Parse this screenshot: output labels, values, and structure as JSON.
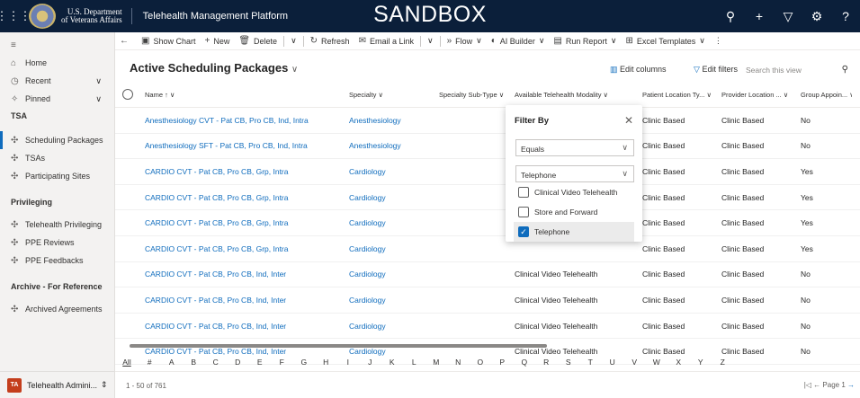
{
  "header": {
    "org_line1": "U.S. Department",
    "org_line2": "of Veterans Affairs",
    "app_title": "Telehealth Management Platform",
    "environment": "SANDBOX"
  },
  "sidebar": {
    "home": "Home",
    "recent": "Recent",
    "pinned": "Pinned",
    "group_tsa": "TSA",
    "scheduling": "Scheduling Packages",
    "tsas": "TSAs",
    "sites": "Participating Sites",
    "group_priv": "Privileging",
    "tele_priv": "Telehealth Privileging",
    "ppe_reviews": "PPE Reviews",
    "ppe_feedbacks": "PPE Feedbacks",
    "group_archive": "Archive - For Reference",
    "archived": "Archived Agreements",
    "area": "Telehealth Admini...",
    "area_badge": "TA"
  },
  "commands": {
    "show_chart": "Show Chart",
    "new": "New",
    "delete": "Delete",
    "refresh": "Refresh",
    "email_link": "Email a Link",
    "flow": "Flow",
    "ai_builder": "AI Builder",
    "run_report": "Run Report",
    "excel_templates": "Excel Templates"
  },
  "view": {
    "title": "Active Scheduling Packages",
    "edit_columns": "Edit columns",
    "edit_filters": "Edit filters",
    "search_placeholder": "Search this view"
  },
  "columns": [
    "Name ↑",
    "Specialty",
    "Specialty Sub-Type",
    "Available Telehealth Modality",
    "Patient Location Ty...",
    "Provider Location ...",
    "Group Appoin..."
  ],
  "rows": [
    {
      "name": "Anesthesiology CVT - Pat CB, Pro CB, Ind, Intra",
      "specialty": "Anesthesiology",
      "subtype": "",
      "modality": "",
      "patient_loc": "Clinic Based",
      "provider_loc": "Clinic Based",
      "group": "No"
    },
    {
      "name": "Anesthesiology SFT - Pat CB, Pro CB, Ind, Intra",
      "specialty": "Anesthesiology",
      "subtype": "",
      "modality": "",
      "patient_loc": "Clinic Based",
      "provider_loc": "Clinic Based",
      "group": "No"
    },
    {
      "name": "CARDIO CVT - Pat CB, Pro CB, Grp, Intra",
      "specialty": "Cardiology",
      "subtype": "",
      "modality": "",
      "patient_loc": "Clinic Based",
      "provider_loc": "Clinic Based",
      "group": "Yes"
    },
    {
      "name": "CARDIO CVT - Pat CB, Pro CB, Grp, Intra",
      "specialty": "Cardiology",
      "subtype": "",
      "modality": "",
      "patient_loc": "Clinic Based",
      "provider_loc": "Clinic Based",
      "group": "Yes"
    },
    {
      "name": "CARDIO CVT - Pat CB, Pro CB, Grp, Intra",
      "specialty": "Cardiology",
      "subtype": "",
      "modality": "",
      "patient_loc": "Clinic Based",
      "provider_loc": "Clinic Based",
      "group": "Yes"
    },
    {
      "name": "CARDIO CVT - Pat CB, Pro CB, Grp, Intra",
      "specialty": "Cardiology",
      "subtype": "",
      "modality": "",
      "patient_loc": "Clinic Based",
      "provider_loc": "Clinic Based",
      "group": "Yes"
    },
    {
      "name": "CARDIO CVT - Pat CB, Pro CB, Ind, Inter",
      "specialty": "Cardiology",
      "subtype": "",
      "modality": "Clinical Video Telehealth",
      "patient_loc": "Clinic Based",
      "provider_loc": "Clinic Based",
      "group": "No"
    },
    {
      "name": "CARDIO CVT - Pat CB, Pro CB, Ind, Inter",
      "specialty": "Cardiology",
      "subtype": "",
      "modality": "Clinical Video Telehealth",
      "patient_loc": "Clinic Based",
      "provider_loc": "Clinic Based",
      "group": "No"
    },
    {
      "name": "CARDIO CVT - Pat CB, Pro CB, Ind, Inter",
      "specialty": "Cardiology",
      "subtype": "",
      "modality": "Clinical Video Telehealth",
      "patient_loc": "Clinic Based",
      "provider_loc": "Clinic Based",
      "group": "No"
    },
    {
      "name": "CARDIO CVT - Pat CB, Pro CB, Ind, Inter",
      "specialty": "Cardiology",
      "subtype": "",
      "modality": "Clinical Video Telehealth",
      "patient_loc": "Clinic Based",
      "provider_loc": "Clinic Based",
      "group": "No"
    }
  ],
  "filter": {
    "title": "Filter By",
    "operator": "Equals",
    "value": "Telephone",
    "options": [
      {
        "label": "Clinical Video Telehealth",
        "checked": false
      },
      {
        "label": "Store and Forward",
        "checked": false
      },
      {
        "label": "Telephone",
        "checked": true
      }
    ]
  },
  "alphabet": [
    "All",
    "#",
    "A",
    "B",
    "C",
    "D",
    "E",
    "F",
    "G",
    "H",
    "I",
    "J",
    "K",
    "L",
    "M",
    "N",
    "O",
    "P",
    "Q",
    "R",
    "S",
    "T",
    "U",
    "V",
    "W",
    "X",
    "Y",
    "Z"
  ],
  "pager": {
    "count": "1 - 50 of 761",
    "page": "Page 1"
  },
  "colors": {
    "topbar": "#0b1f3a",
    "link": "#0f6cbd",
    "badge": "#c43e1c"
  }
}
